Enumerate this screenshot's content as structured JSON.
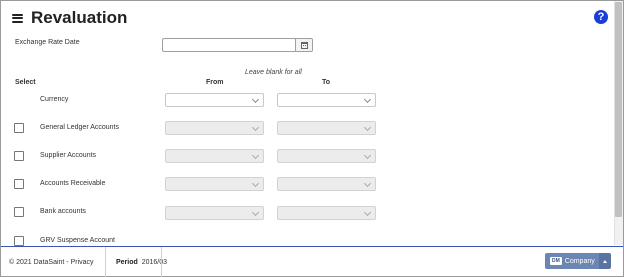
{
  "page": {
    "title": "Revaluation",
    "help_icon": "help-icon"
  },
  "form": {
    "exchange_rate_label": "Exchange Rate Date",
    "exchange_rate_value": "",
    "hint": "Leave blank for all",
    "select_header": "Select",
    "from_header": "From",
    "to_header": "To",
    "rows": [
      {
        "label": "Currency",
        "from": "",
        "to": "",
        "enabled": true,
        "has_checkbox": false
      },
      {
        "label": "General Ledger Accounts",
        "from": "",
        "to": "",
        "enabled": false,
        "has_checkbox": true,
        "checked": false
      },
      {
        "label": "Supplier Accounts",
        "from": "",
        "to": "",
        "enabled": false,
        "has_checkbox": true,
        "checked": false
      },
      {
        "label": "Accounts Receivable",
        "from": "",
        "to": "",
        "enabled": false,
        "has_checkbox": true,
        "checked": false
      },
      {
        "label": "Bank accounts",
        "from": "",
        "to": "",
        "enabled": false,
        "has_checkbox": true,
        "checked": false
      },
      {
        "label": "GRV Suspense Account",
        "enabled": false,
        "has_checkbox": true,
        "checked": false
      }
    ]
  },
  "footer": {
    "copyright": "© 2021 DataSaint - ",
    "privacy_link": "Privacy",
    "period_label": "Period",
    "period_value": "2016/03",
    "company_badge": "DM",
    "company_label": "Company"
  },
  "colors": {
    "accent": "#1a3fd6",
    "company_button": "#6b86b3",
    "footer_border": "#3a55b5"
  }
}
